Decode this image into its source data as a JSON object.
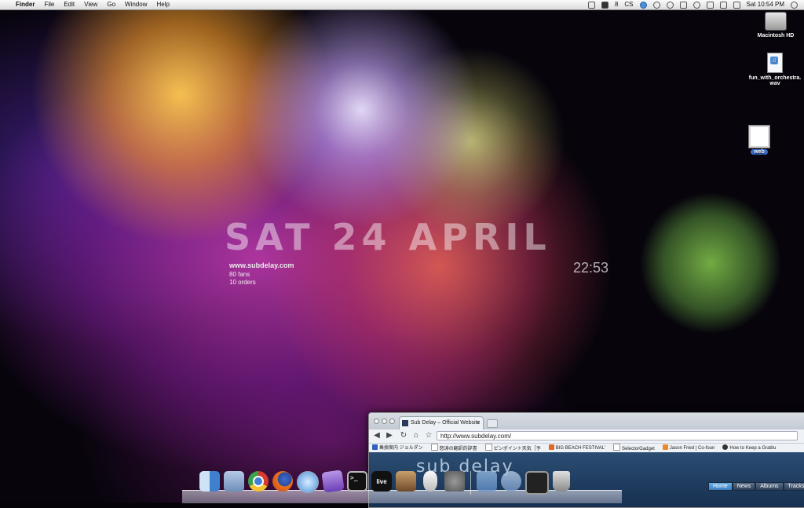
{
  "menubar": {
    "apple": "",
    "app_name": "Finder",
    "menus": [
      "File",
      "Edit",
      "View",
      "Go",
      "Window",
      "Help"
    ],
    "status": {
      "input_num": "8",
      "cs_label": "CS",
      "datetime": "Sat 10:54 PM"
    }
  },
  "desktop_icons": [
    {
      "label": "Macintosh HD",
      "icon": "hard-drive-icon"
    },
    {
      "label": "fun_with_orchestra.wav",
      "icon": "audio-file-icon"
    },
    {
      "label": "web",
      "icon": "folder-icon"
    }
  ],
  "wallpaper": {
    "date_text": "SAT 24 APRIL",
    "clock": "22:53",
    "site": "www.subdelay.com",
    "fans": "80 fans",
    "orders": "10 orders"
  },
  "browser": {
    "tab_title": "Sub Delay – Official Website",
    "tab_close": "×",
    "url": "http://www.subdelay.com/",
    "back": "◀",
    "forward": "▶",
    "reload": "↻",
    "home": "⌂",
    "star": "☆",
    "bookmarks": [
      "乗換案内 ジョルダン",
      "怒涛の翻訳的辞書",
      "ピンポイント天気［予",
      "BIG BEACH FESTIVAL'",
      "SelectorGadget",
      "Jason Fried | Co-foun",
      "How to Keep a Gratitu"
    ],
    "site_banner": "sub delay",
    "site_nav": [
      "Home",
      "News",
      "Albums",
      "Tracks"
    ]
  },
  "dock": {
    "items": [
      {
        "name": "finder",
        "label": ""
      },
      {
        "name": "preview",
        "label": ""
      },
      {
        "name": "chrome",
        "label": ""
      },
      {
        "name": "firefox",
        "label": ""
      },
      {
        "name": "safari",
        "label": ""
      },
      {
        "name": "itunes",
        "label": ""
      },
      {
        "name": "terminal",
        "label": ">_"
      },
      {
        "name": "ableton-live",
        "label": "live"
      },
      {
        "name": "iphoto",
        "label": ""
      },
      {
        "name": "mouse",
        "label": ""
      },
      {
        "name": "system-preferences",
        "label": ""
      },
      {
        "name": "applications",
        "label": ""
      },
      {
        "name": "utilities",
        "label": ""
      },
      {
        "name": "console",
        "label": ""
      },
      {
        "name": "trash",
        "label": ""
      }
    ]
  }
}
